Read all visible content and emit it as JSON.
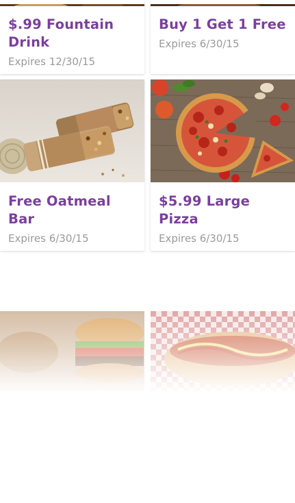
{
  "deals": [
    {
      "title": "$.99 Fountain Drink",
      "expires": "Expires 12/30/15"
    },
    {
      "title": "Buy 1 Get 1 Free",
      "expires": "Expires 6/30/15"
    },
    {
      "title": "Free Oatmeal Bar",
      "expires": "Expires 6/30/15"
    },
    {
      "title": "$5.99 Large Pizza",
      "expires": "Expires 6/30/15"
    }
  ],
  "colors": {
    "title": "#7b3f9e",
    "expires": "#9a9a9a",
    "background": "#ffffff"
  }
}
